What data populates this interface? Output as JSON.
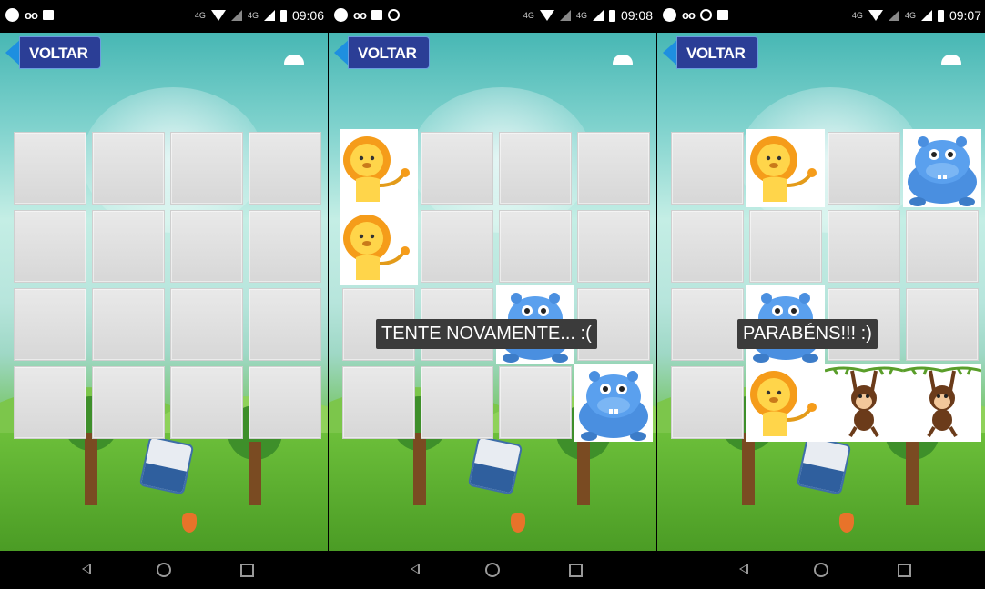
{
  "screens": [
    {
      "status": {
        "time": "09:06",
        "network": "4G",
        "network2": "4G"
      },
      "back_label": "VOLTAR",
      "toast": "",
      "cards": []
    },
    {
      "status": {
        "time": "09:08",
        "network": "4G",
        "network2": "4G"
      },
      "back_label": "VOLTAR",
      "toast": "TENTE NOVAMENTE... :(",
      "cards": [
        {
          "row": 0,
          "col": 0,
          "animal": "lion"
        },
        {
          "row": 1,
          "col": 0,
          "animal": "lion"
        },
        {
          "row": 2,
          "col": 2,
          "animal": "hippo"
        },
        {
          "row": 3,
          "col": 3,
          "animal": "hippo"
        }
      ]
    },
    {
      "status": {
        "time": "09:07",
        "network": "4G",
        "network2": "4G"
      },
      "back_label": "VOLTAR",
      "toast": "PARABÉNS!!! :)",
      "cards": [
        {
          "row": 0,
          "col": 1,
          "animal": "lion"
        },
        {
          "row": 0,
          "col": 3,
          "animal": "hippo"
        },
        {
          "row": 2,
          "col": 1,
          "animal": "hippo"
        },
        {
          "row": 3,
          "col": 1,
          "animal": "lion"
        },
        {
          "row": 3,
          "col": 2,
          "animal": "monkey"
        },
        {
          "row": 3,
          "col": 3,
          "animal": "monkey"
        }
      ]
    }
  ],
  "colors": {
    "back_button": "#2b3e96",
    "back_arrow": "#1e8fe0",
    "toast_bg": "#3b3b3b"
  }
}
